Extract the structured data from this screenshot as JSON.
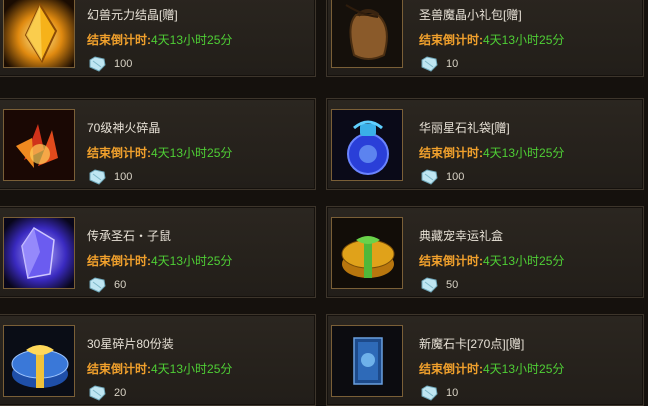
{
  "countdown_label": "结束倒计时:",
  "countdown_value": "4天13小时25分",
  "items": [
    {
      "name": "幻兽元力结晶[赠]",
      "price": "100",
      "icon": "amber-crystal-icon"
    },
    {
      "name": "圣兽魔晶小礼包[赠]",
      "price": "10",
      "icon": "leather-pouch-icon"
    },
    {
      "name": "70级神火碎晶",
      "price": "100",
      "icon": "fire-crystal-icon"
    },
    {
      "name": "华丽星石礼袋[赠]",
      "price": "100",
      "icon": "blue-potion-bag-icon"
    },
    {
      "name": "传承圣石・子鼠",
      "price": "60",
      "icon": "purple-gem-icon"
    },
    {
      "name": "典藏宠幸运礼盒",
      "price": "50",
      "icon": "round-gift-box-icon"
    },
    {
      "name": "30星碎片80份装",
      "price": "20",
      "icon": "blue-gift-box-icon"
    },
    {
      "name": "新魔石卡[270点][赠]",
      "price": "10",
      "icon": "magic-card-icon"
    }
  ],
  "colors": {
    "label": "#f0a02c",
    "value": "#4fcf35",
    "name": "#e7e1d6",
    "card_bg": "#2b2620",
    "frame": "#7a5f37"
  }
}
